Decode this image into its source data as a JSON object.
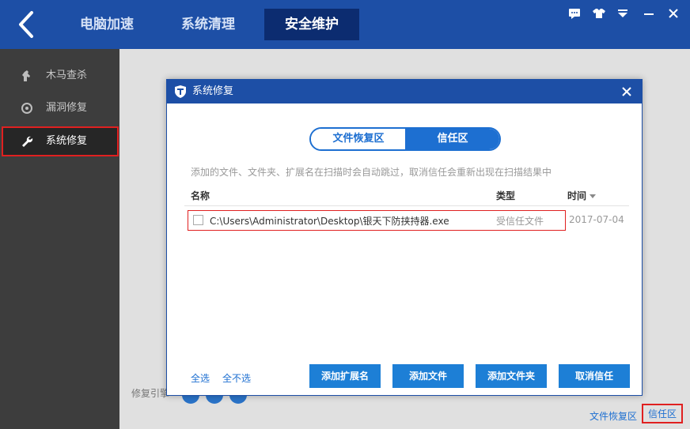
{
  "header": {
    "tabs": [
      {
        "label": "电脑加速"
      },
      {
        "label": "系统清理"
      },
      {
        "label": "安全维护"
      }
    ]
  },
  "sidebar": {
    "items": [
      {
        "label": "木马查杀",
        "icon": "horse-icon"
      },
      {
        "label": "漏洞修复",
        "icon": "target-icon"
      },
      {
        "label": "系统修复",
        "icon": "wrench-icon"
      }
    ]
  },
  "main": {
    "engine_label": "修复引擎",
    "bottom_links": [
      {
        "label": "文件恢复区"
      },
      {
        "label": "信任区"
      }
    ]
  },
  "dialog": {
    "title": "系统修复",
    "segments": [
      {
        "label": "文件恢复区"
      },
      {
        "label": "信任区"
      }
    ],
    "hint": "添加的文件、文件夹、扩展名在扫描时会自动跳过，取消信任会重新出现在扫描结果中",
    "columns": {
      "name": "名称",
      "type": "类型",
      "time": "时间"
    },
    "rows": [
      {
        "path": "C:\\Users\\Administrator\\Desktop\\银天下防挟持器.exe",
        "type": "受信任文件",
        "time": "2017-07-04"
      }
    ],
    "select_all": "全选",
    "select_none": "全不选",
    "buttons": {
      "add_ext": "添加扩展名",
      "add_file": "添加文件",
      "add_folder": "添加文件夹",
      "cancel_trust": "取消信任"
    }
  },
  "colors": {
    "header_blue": "#1d4fa6",
    "active_tab": "#0c2c70",
    "accent": "#1d7fd6",
    "highlight_red": "#e02020"
  }
}
